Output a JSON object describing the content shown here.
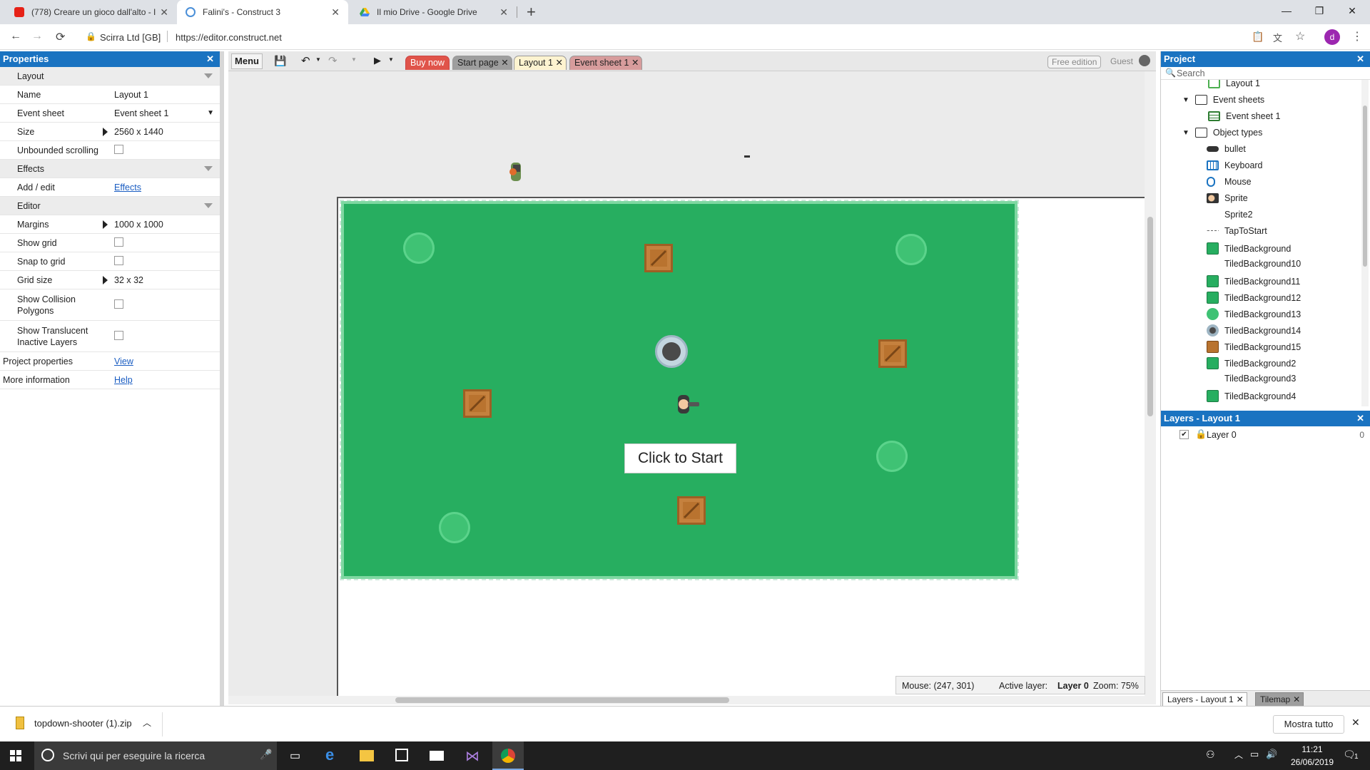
{
  "browser": {
    "tabs": [
      {
        "title": "(778) Creare un gioco dall'alto - I"
      },
      {
        "title": "Falini's - Construct 3"
      },
      {
        "title": "Il mio Drive - Google Drive"
      }
    ],
    "site_label": "Scirra Ltd [GB]",
    "url": "https://editor.construct.net"
  },
  "properties": {
    "title": "Properties",
    "sections": {
      "layout": "Layout",
      "effects": "Effects",
      "editor": "Editor"
    },
    "rows": [
      {
        "key": "Name",
        "value": "Layout 1"
      },
      {
        "key": "Event sheet",
        "value": "Event sheet 1"
      },
      {
        "key": "Size",
        "value": "2560 x 1440"
      },
      {
        "key": "Unbounded scrolling",
        "value": ""
      },
      {
        "key": "Add / edit",
        "value": "Effects"
      },
      {
        "key": "Margins",
        "value": "1000 x 1000"
      },
      {
        "key": "Show grid",
        "value": ""
      },
      {
        "key": "Snap to grid",
        "value": ""
      },
      {
        "key": "Grid size",
        "value": "32 x 32"
      },
      {
        "key": "Show Collision Polygons",
        "value": ""
      },
      {
        "key": "Show Translucent Inactive Layers",
        "value": ""
      },
      {
        "key": "Project properties",
        "value": "View"
      },
      {
        "key": "More information",
        "value": "Help"
      }
    ]
  },
  "toolbar": {
    "menu": "Menu",
    "buy_now": "Buy now",
    "tabs": [
      "Start page",
      "Layout 1",
      "Event sheet 1"
    ],
    "free_edition": "Free edition",
    "guest": "Guest"
  },
  "canvas": {
    "start_text": "Click to Start",
    "status_mouse_label": "Mouse: (247, 301)",
    "status_layer_label": "Active layer:",
    "status_layer_value": "Layer 0",
    "status_zoom": "Zoom: 75%"
  },
  "project": {
    "title": "Project",
    "search_placeholder": "Search",
    "items": [
      {
        "label": "Layout 1",
        "icon": "layout-icon"
      },
      {
        "label": "Event sheets",
        "icon": "folder-icon"
      },
      {
        "label": "Event sheet 1",
        "icon": "event-sheet-icon"
      },
      {
        "label": "Object types",
        "icon": "folder-icon"
      },
      {
        "label": "bullet",
        "icon": "bullet-icon"
      },
      {
        "label": "Keyboard",
        "icon": "keyboard-icon"
      },
      {
        "label": "Mouse",
        "icon": "mouse-icon"
      },
      {
        "label": "Sprite",
        "icon": "sprite-icon"
      },
      {
        "label": "Sprite2",
        "icon": "none"
      },
      {
        "label": "TapToStart",
        "icon": "text-icon"
      },
      {
        "label": "TiledBackground",
        "icon": "green-square-icon"
      },
      {
        "label": "TiledBackground10",
        "icon": "none"
      },
      {
        "label": "TiledBackground11",
        "icon": "green-square-icon"
      },
      {
        "label": "TiledBackground12",
        "icon": "green-square-icon"
      },
      {
        "label": "TiledBackground13",
        "icon": "bush-icon"
      },
      {
        "label": "TiledBackground14",
        "icon": "hole-icon"
      },
      {
        "label": "TiledBackground15",
        "icon": "crate-icon"
      },
      {
        "label": "TiledBackground2",
        "icon": "green-square-icon"
      },
      {
        "label": "TiledBackground3",
        "icon": "none"
      },
      {
        "label": "TiledBackground4",
        "icon": "green-square-icon"
      }
    ]
  },
  "layers": {
    "title": "Layers - Layout 1",
    "items": [
      {
        "name": "Layer 0",
        "count": "0"
      }
    ],
    "bottom_tabs": [
      "Layers - Layout 1",
      "Tilemap"
    ]
  },
  "download": {
    "file": "topdown-shooter (1).zip",
    "show_all": "Mostra tutto"
  },
  "taskbar": {
    "search": "Scrivi qui per eseguire la ricerca",
    "time": "11:21",
    "date": "26/06/2019",
    "notifications": "1"
  },
  "colors": {
    "accent": "#1a73c1",
    "grass": "#27ae60",
    "buy_now": "#e0544a"
  }
}
